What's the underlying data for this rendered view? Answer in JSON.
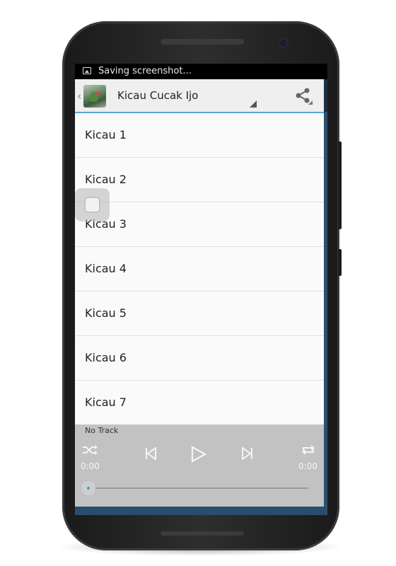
{
  "status_bar": {
    "notification": "Saving screenshot..."
  },
  "action_bar": {
    "title": "Kicau Cucak Ijo",
    "icons": [
      "back-chevron",
      "app-icon",
      "spinner-indicator",
      "share-icon"
    ]
  },
  "list": {
    "items": [
      "Kicau 1",
      "Kicau 2",
      "Kicau 3",
      "Kicau 4",
      "Kicau 5",
      "Kicau 6",
      "Kicau 7"
    ]
  },
  "player": {
    "now_playing": "No Track",
    "elapsed": "0:00",
    "duration": "0:00",
    "progress": 0,
    "controls": [
      "shuffle-icon",
      "previous-icon",
      "play-icon",
      "next-icon",
      "repeat-icon"
    ]
  },
  "colors": {
    "accent": "#58a9d6",
    "player_bg": "#c2c2c2",
    "seek_dot": "#2aa7d8"
  }
}
